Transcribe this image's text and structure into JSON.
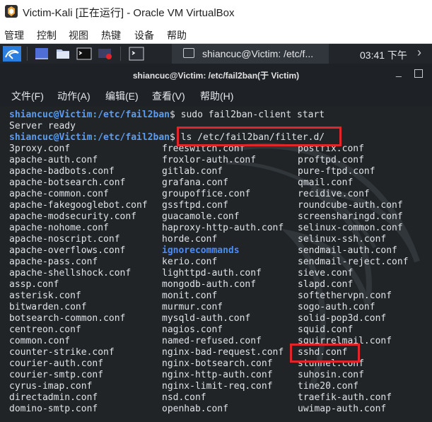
{
  "vbox": {
    "title": "Victim-Kali [正在运行] - Oracle VM VirtualBox",
    "menu": [
      "管理",
      "控制",
      "视图",
      "热键",
      "设备",
      "帮助"
    ]
  },
  "panel": {
    "task_label": "shiancuc@Victim: /etc/f...",
    "clock": "03:41 下午",
    "more": "›"
  },
  "terminal": {
    "title": "shiancuc@Victim: /etc/fail2ban(于 Victim)",
    "menu": [
      "文件(F)",
      "动作(A)",
      "编辑(E)",
      "查看(V)",
      "帮助(H)"
    ],
    "line1": {
      "user": "shiancuc@Victim",
      "path": ":/etc/fail2ban",
      "cmd": "$ sudo fail2ban-client start"
    },
    "line2": "Server ready",
    "line3": {
      "user": "shiancuc@Victim",
      "path": ":/etc/fail2ban",
      "dollar": "$ ",
      "cmd": "ls /etc/fail2ban/filter.d/"
    },
    "listing": {
      "col1": [
        "3proxy.conf",
        "apache-auth.conf",
        "apache-badbots.conf",
        "apache-botsearch.conf",
        "apache-common.conf",
        "apache-fakegooglebot.conf",
        "apache-modsecurity.conf",
        "apache-nohome.conf",
        "apache-noscript.conf",
        "apache-overflows.conf",
        "apache-pass.conf",
        "apache-shellshock.conf",
        "assp.conf",
        "asterisk.conf",
        "bitwarden.conf",
        "botsearch-common.conf",
        "centreon.conf",
        "common.conf",
        "counter-strike.conf",
        "courier-auth.conf",
        "courier-smtp.conf",
        "cyrus-imap.conf",
        "directadmin.conf",
        "domino-smtp.conf"
      ],
      "col2": [
        "freeswitch.conf",
        "froxlor-auth.conf",
        "gitlab.conf",
        "grafana.conf",
        "groupoffice.conf",
        "gssftpd.conf",
        "guacamole.conf",
        "haproxy-http-auth.conf",
        "horde.conf",
        "ignorecommands",
        "kerio.conf",
        "lighttpd-auth.conf",
        "mongodb-auth.conf",
        "monit.conf",
        "murmur.conf",
        "mysqld-auth.conf",
        "nagios.conf",
        "named-refused.conf",
        "nginx-bad-request.conf",
        "nginx-botsearch.conf",
        "nginx-http-auth.conf",
        "nginx-limit-req.conf",
        "nsd.conf",
        "openhab.conf"
      ],
      "col3": [
        "postfix.conf",
        "proftpd.conf",
        "pure-ftpd.conf",
        "qmail.conf",
        "recidive.conf",
        "roundcube-auth.conf",
        "screensharingd.conf",
        "selinux-common.conf",
        "selinux-ssh.conf",
        "sendmail-auth.conf",
        "sendmail-reject.conf",
        "sieve.conf",
        "slapd.conf",
        "softethervpn.conf",
        "sogo-auth.conf",
        "solid-pop3d.conf",
        "squid.conf",
        "squirrelmail.conf",
        "sshd.conf",
        "stunnel.conf",
        "suhosin.conf",
        "tine20.conf",
        "traefik-auth.conf",
        "uwimap-auth.conf"
      ]
    }
  },
  "colors": {
    "prompt": "#5b9cf0",
    "directory": "#4b8bf5",
    "highlight": "#e0262b"
  }
}
